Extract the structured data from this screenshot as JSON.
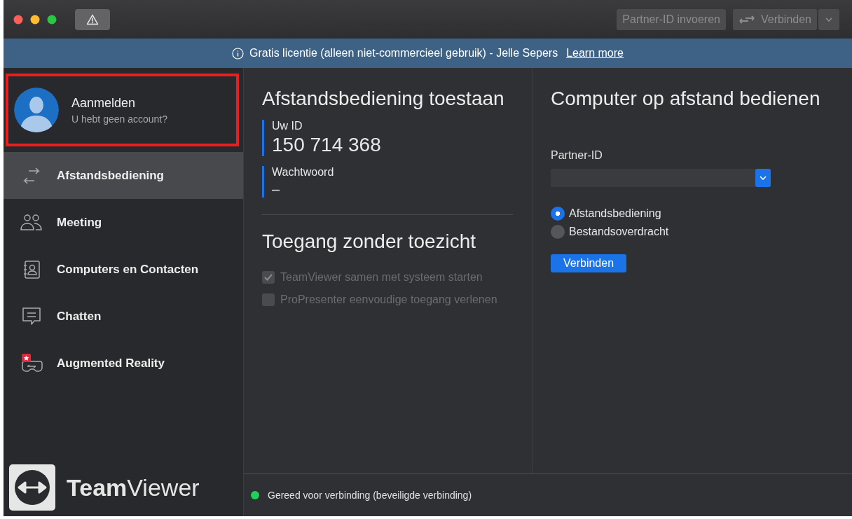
{
  "toolbar": {
    "buttons": [
      {
        "label": "Partner-ID invoeren",
        "disabled": true
      },
      {
        "label": "Verbinden",
        "disabled": true,
        "dropdown": true
      }
    ]
  },
  "banner": {
    "text": "Gratis licentie (alleen niet-commercieel gebruik) - Jelle Sepers",
    "link": "Learn more"
  },
  "account": {
    "name": "Aanmelden",
    "subtitle": "U hebt geen account?",
    "highlighted": true
  },
  "sidebar": {
    "items": [
      {
        "label": "Afstandsbediening",
        "selected": true
      },
      {
        "label": "Meeting",
        "selected": false
      },
      {
        "label": "Computers en Contacten",
        "selected": false
      },
      {
        "label": "Chatten",
        "selected": false
      },
      {
        "label": "Augmented Reality",
        "selected": false
      }
    ],
    "logo": "**Team**Viewer"
  },
  "allow_remote": {
    "title": "Afstandsbediening toestaan",
    "fields": [
      {
        "label": "Uw ID",
        "value": "150 714 368"
      },
      {
        "label": "Wachtwoord",
        "value": "–"
      }
    ]
  },
  "unattended": {
    "title": "Toegang zonder toezicht",
    "options": [
      {
        "label": "TeamViewer samen met systeem starten",
        "checked": true,
        "disabled": true
      },
      {
        "label": "ProPresenter eenvoudige toegang verlenen",
        "checked": false,
        "disabled": true
      }
    ]
  },
  "remote_control": {
    "title": "Computer op afstand bedienen",
    "partner_label": "Partner-ID",
    "modes": [
      {
        "label": "Afstandsbediening",
        "selected": true
      },
      {
        "label": "Bestandsoverdracht",
        "selected": false
      }
    ],
    "connect": "Verbinden"
  },
  "status_bar": {
    "text": "Gereed voor verbinding (beveiligde verbinding)",
    "ready": true
  }
}
